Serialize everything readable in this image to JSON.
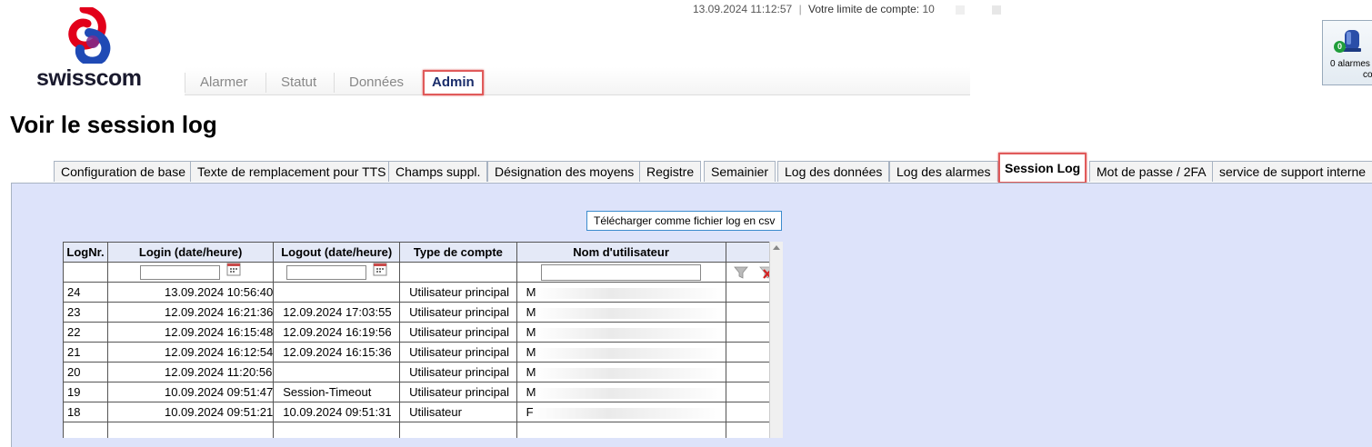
{
  "header": {
    "brand": "swisscom",
    "datetime": "13.09.2024 11:12:57",
    "separator": "|",
    "limit_label": "Votre limite de compte:",
    "limit_value_masked": "10"
  },
  "main_tabs": [
    {
      "label": "Alarmer",
      "active": false
    },
    {
      "label": "Statut",
      "active": false
    },
    {
      "label": "Données",
      "active": false
    },
    {
      "label": "Admin",
      "active": true
    }
  ],
  "alarm_widget": {
    "count": "0",
    "line1": "0 alarmes",
    "line2": "cours"
  },
  "page_title": "Voir le session log",
  "sub_tabs": [
    {
      "label": "Configuration de base",
      "active": false
    },
    {
      "label": "Texte de remplacement pour TTS",
      "active": false
    },
    {
      "label": "Champs suppl.",
      "active": false
    },
    {
      "label": "Désignation des moyens",
      "active": false
    },
    {
      "label": "Registre",
      "active": false
    },
    {
      "label": "Semainier",
      "active": false
    },
    {
      "label": "Log des données",
      "active": false
    },
    {
      "label": "Log des alarmes",
      "active": false
    },
    {
      "label": "Session Log",
      "active": true
    },
    {
      "label": "Mot de passe / 2FA",
      "active": false
    },
    {
      "label": "service de support interne",
      "active": false
    }
  ],
  "csv_button": "Télécharger comme fichier log en csv",
  "table": {
    "columns": [
      "LogNr.",
      "Login (date/heure)",
      "Logout (date/heure)",
      "Type de compte",
      "Nom d'utilisateur",
      ""
    ],
    "rows": [
      {
        "nr": "24",
        "login": "13.09.2024 10:56:40",
        "logout": "",
        "type": "Utilisateur principal",
        "user": "M"
      },
      {
        "nr": "23",
        "login": "12.09.2024 16:21:36",
        "logout": "12.09.2024 17:03:55",
        "type": "Utilisateur principal",
        "user": "M"
      },
      {
        "nr": "22",
        "login": "12.09.2024 16:15:48",
        "logout": "12.09.2024 16:19:56",
        "type": "Utilisateur principal",
        "user": "M"
      },
      {
        "nr": "21",
        "login": "12.09.2024 16:12:54",
        "logout": "12.09.2024 16:15:36",
        "type": "Utilisateur principal",
        "user": "M"
      },
      {
        "nr": "20",
        "login": "12.09.2024 11:20:56",
        "logout": "",
        "type": "Utilisateur principal",
        "user": "M"
      },
      {
        "nr": "19",
        "login": "10.09.2024 09:51:47",
        "logout": "Session-Timeout",
        "type": "Utilisateur principal",
        "user": "M"
      },
      {
        "nr": "18",
        "login": "10.09.2024 09:51:21",
        "logout": "10.09.2024 09:51:31",
        "type": "Utilisateur",
        "user": "F"
      }
    ]
  },
  "colors": {
    "panel_bg": "#dde3fa",
    "highlight": "#e05a5a",
    "brand_red": "#e2001a",
    "brand_blue": "#1f4ab5"
  }
}
